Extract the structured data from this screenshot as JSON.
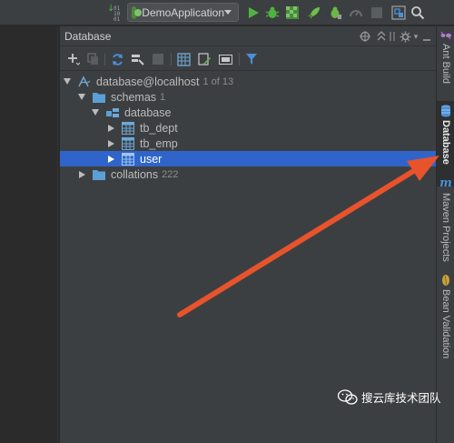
{
  "toolbar": {
    "run_config_label": "DemoApplication",
    "vcs_digits": [
      "01",
      "10",
      "01"
    ]
  },
  "panel": {
    "title": "Database"
  },
  "tree": [
    {
      "label": "database@localhost",
      "count": "1 of 13",
      "depth": 0,
      "expanded": true,
      "icon": "datasource-icon"
    },
    {
      "label": "schemas",
      "count": "1",
      "depth": 1,
      "expanded": true,
      "icon": "folder-icon"
    },
    {
      "label": "database",
      "count": "",
      "depth": 2,
      "expanded": true,
      "icon": "schema-icon"
    },
    {
      "label": "tb_dept",
      "count": "",
      "depth": 3,
      "expanded": false,
      "icon": "table-icon"
    },
    {
      "label": "tb_emp",
      "count": "",
      "depth": 3,
      "expanded": false,
      "icon": "table-icon"
    },
    {
      "label": "user",
      "count": "",
      "depth": 3,
      "expanded": false,
      "icon": "table-icon",
      "selected": true
    },
    {
      "label": "collations",
      "count": "222",
      "depth": 1,
      "expanded": false,
      "icon": "folder-icon"
    }
  ],
  "stripe": {
    "tabs": [
      "Ant Build",
      "Database",
      "Maven Projects",
      "Bean Validation"
    ]
  },
  "watermark": {
    "text": "搜云库技术团队"
  },
  "colors": {
    "panel_bg": "#3c3f41",
    "editor_bg": "#2b2b2b",
    "selection": "#2f65ca",
    "annotation_arrow": "#e8532b",
    "folder": "#5aa0d6",
    "table": "#6fa8d8"
  }
}
